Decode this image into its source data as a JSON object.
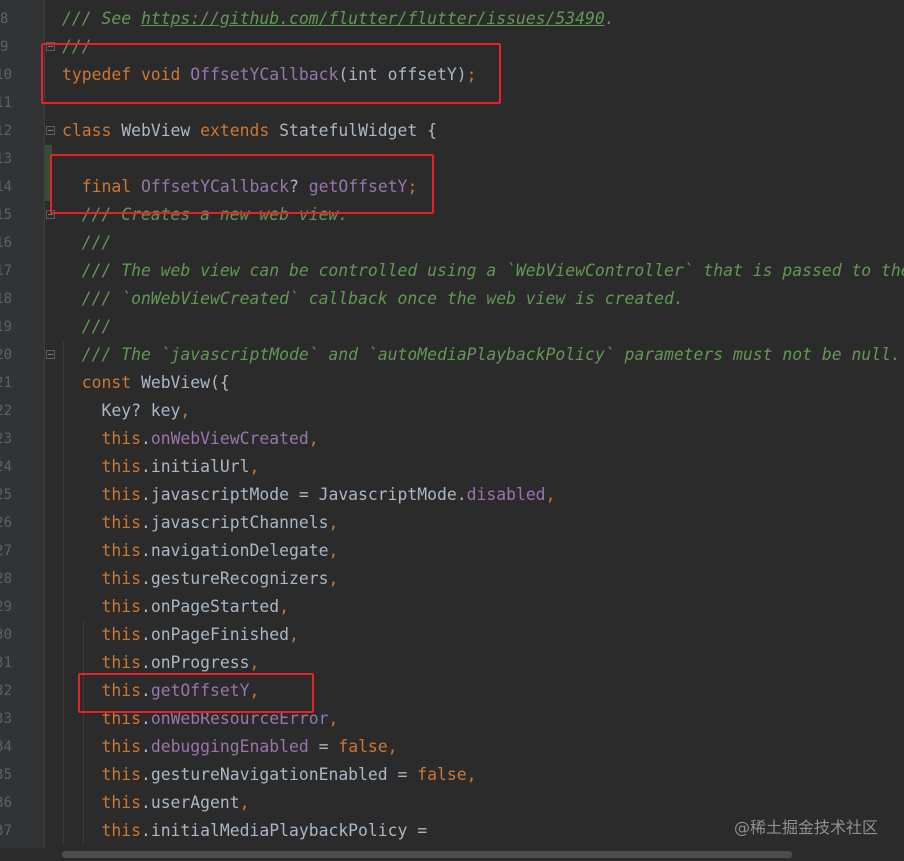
{
  "editor": {
    "lines": [
      {
        "n": "8",
        "tokens": [
          {
            "c": "cm",
            "t": "/// See "
          },
          {
            "c": "lnk",
            "t": "https://github.com/flutter/flutter/issues/53490"
          },
          {
            "c": "cm",
            "t": "."
          }
        ]
      },
      {
        "n": "9",
        "tokens": [
          {
            "c": "cm",
            "t": "///"
          }
        ]
      },
      {
        "n": "10",
        "tokens": [
          {
            "c": "kw",
            "t": "typedef void "
          },
          {
            "c": "tp",
            "t": "OffsetYCallback"
          },
          {
            "c": "pl",
            "t": "(int offsetY)"
          },
          {
            "c": "pu",
            "t": ";"
          }
        ]
      },
      {
        "n": "11",
        "tokens": []
      },
      {
        "n": "12",
        "tokens": [
          {
            "c": "kw",
            "t": "class "
          },
          {
            "c": "pl",
            "t": "WebView "
          },
          {
            "c": "kw",
            "t": "extends "
          },
          {
            "c": "pl",
            "t": "StatefulWidget {"
          }
        ]
      },
      {
        "n": "13",
        "tokens": []
      },
      {
        "n": "14",
        "tokens": [
          {
            "c": "pl",
            "t": "  "
          },
          {
            "c": "kw",
            "t": "final "
          },
          {
            "c": "tp",
            "t": "OffsetYCallback"
          },
          {
            "c": "pl",
            "t": "? "
          },
          {
            "c": "tp",
            "t": "getOffsetY"
          },
          {
            "c": "pu",
            "t": ";"
          }
        ]
      },
      {
        "n": "15",
        "tokens": [
          {
            "c": "cm",
            "t": "  /// Creates a new web view."
          }
        ]
      },
      {
        "n": "16",
        "tokens": [
          {
            "c": "cm",
            "t": "  ///"
          }
        ]
      },
      {
        "n": "17",
        "tokens": [
          {
            "c": "cm",
            "t": "  /// The web view can be controlled using a `WebViewController` that is passed to the"
          }
        ]
      },
      {
        "n": "18",
        "tokens": [
          {
            "c": "cm",
            "t": "  /// `onWebViewCreated` callback once the web view is created."
          }
        ]
      },
      {
        "n": "19",
        "tokens": [
          {
            "c": "cm",
            "t": "  ///"
          }
        ]
      },
      {
        "n": "20",
        "tokens": [
          {
            "c": "cm",
            "t": "  /// The `javascriptMode` and `autoMediaPlaybackPolicy` parameters must not be null."
          }
        ]
      },
      {
        "n": "21",
        "tokens": [
          {
            "c": "kw",
            "t": "  const "
          },
          {
            "c": "pl",
            "t": "WebView({"
          }
        ]
      },
      {
        "n": "22",
        "tokens": [
          {
            "c": "pl",
            "t": "    Key? key"
          },
          {
            "c": "pu",
            "t": ","
          }
        ]
      },
      {
        "n": "23",
        "tokens": [
          {
            "c": "kw",
            "t": "    this"
          },
          {
            "c": "pl",
            "t": "."
          },
          {
            "c": "tp",
            "t": "onWebViewCreated"
          },
          {
            "c": "pu",
            "t": ","
          }
        ]
      },
      {
        "n": "24",
        "tokens": [
          {
            "c": "kw",
            "t": "    this"
          },
          {
            "c": "pl",
            "t": ".initialUrl"
          },
          {
            "c": "pu",
            "t": ","
          }
        ]
      },
      {
        "n": "25",
        "tokens": [
          {
            "c": "kw",
            "t": "    this"
          },
          {
            "c": "pl",
            "t": ".javascriptMode = JavascriptMode."
          },
          {
            "c": "tp",
            "t": "disabled"
          },
          {
            "c": "pu",
            "t": ","
          }
        ]
      },
      {
        "n": "26",
        "tokens": [
          {
            "c": "kw",
            "t": "    this"
          },
          {
            "c": "pl",
            "t": ".javascriptChannels"
          },
          {
            "c": "pu",
            "t": ","
          }
        ]
      },
      {
        "n": "27",
        "tokens": [
          {
            "c": "kw",
            "t": "    this"
          },
          {
            "c": "pl",
            "t": ".navigationDelegate"
          },
          {
            "c": "pu",
            "t": ","
          }
        ]
      },
      {
        "n": "28",
        "tokens": [
          {
            "c": "kw",
            "t": "    this"
          },
          {
            "c": "pl",
            "t": ".gestureRecognizers"
          },
          {
            "c": "pu",
            "t": ","
          }
        ]
      },
      {
        "n": "29",
        "tokens": [
          {
            "c": "kw",
            "t": "    this"
          },
          {
            "c": "pl",
            "t": ".onPageStarted"
          },
          {
            "c": "pu",
            "t": ","
          }
        ]
      },
      {
        "n": "30",
        "tokens": [
          {
            "c": "kw",
            "t": "    this"
          },
          {
            "c": "pl",
            "t": ".onPageFinished"
          },
          {
            "c": "pu",
            "t": ","
          }
        ]
      },
      {
        "n": "31",
        "tokens": [
          {
            "c": "kw",
            "t": "    this"
          },
          {
            "c": "pl",
            "t": ".onProgress"
          },
          {
            "c": "pu",
            "t": ","
          }
        ]
      },
      {
        "n": "32",
        "tokens": [
          {
            "c": "kw",
            "t": "    this"
          },
          {
            "c": "pl",
            "t": "."
          },
          {
            "c": "tp",
            "t": "getOffsetY"
          },
          {
            "c": "pu",
            "t": ","
          }
        ]
      },
      {
        "n": "33",
        "tokens": [
          {
            "c": "kw",
            "t": "    this"
          },
          {
            "c": "pl",
            "t": "."
          },
          {
            "c": "tp",
            "t": "onWebResourceError"
          },
          {
            "c": "pu",
            "t": ","
          }
        ]
      },
      {
        "n": "34",
        "tokens": [
          {
            "c": "kw",
            "t": "    this"
          },
          {
            "c": "pl",
            "t": "."
          },
          {
            "c": "tp",
            "t": "debuggingEnabled"
          },
          {
            "c": "pl",
            "t": " = "
          },
          {
            "c": "kw",
            "t": "false"
          },
          {
            "c": "pu",
            "t": ","
          }
        ]
      },
      {
        "n": "35",
        "tokens": [
          {
            "c": "kw",
            "t": "    this"
          },
          {
            "c": "pl",
            "t": ".gestureNavigationEnabled = "
          },
          {
            "c": "kw",
            "t": "false"
          },
          {
            "c": "pu",
            "t": ","
          }
        ]
      },
      {
        "n": "36",
        "tokens": [
          {
            "c": "kw",
            "t": "    this"
          },
          {
            "c": "pl",
            "t": ".userAgent"
          },
          {
            "c": "pu",
            "t": ","
          }
        ]
      },
      {
        "n": "37",
        "tokens": [
          {
            "c": "kw",
            "t": "    this"
          },
          {
            "c": "pl",
            "t": ".initialMediaPlaybackPolicy ="
          }
        ]
      }
    ],
    "fold_lines": [
      "9",
      "12",
      "15",
      "20"
    ],
    "changed_lines": [
      "13",
      "14"
    ]
  },
  "colors": {
    "background": "#2b2b2b",
    "keyword": "#cc7832",
    "field": "#9876aa",
    "comment": "#629755",
    "plain": "#a9b7c6",
    "highlight_box": "#e8202a"
  },
  "watermark": "@稀土掘金技术社区"
}
